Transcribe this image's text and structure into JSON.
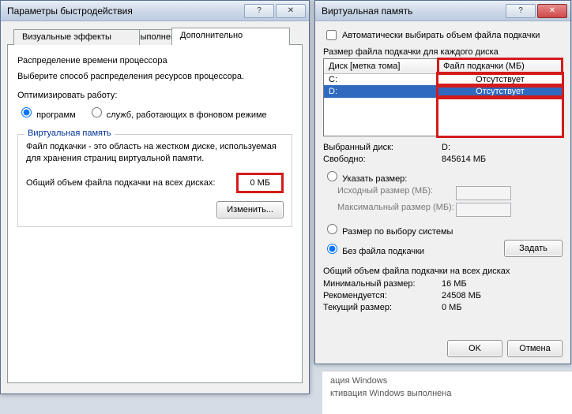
{
  "win1": {
    "title": "Параметры быстродействия",
    "tabs": {
      "dep": "Предотвращение выполнения данных",
      "visual": "Визуальные эффекты",
      "advanced": "Дополнительно"
    },
    "sched_heading": "Распределение времени процессора",
    "sched_text": "Выберите способ распределения ресурсов процессора.",
    "sched_optimize": "Оптимизировать работу:",
    "radio_programs": "программ",
    "radio_services": "служб, работающих в фоновом режиме",
    "vm_legend": "Виртуальная память",
    "vm_text": "Файл подкачки - это область на жестком диске, используемая для хранения страниц виртуальной памяти.",
    "vm_total_label": "Общий объем файла подкачки на всех дисках:",
    "vm_total_value": "0 МБ",
    "change_btn": "Изменить..."
  },
  "win2": {
    "title": "Виртуальная память",
    "auto_manage": "Автоматически выбирать объем файла подкачки",
    "size_each_label": "Размер файла подкачки для каждого диска",
    "col_drive": "Диск [метка тома]",
    "col_pf": "Файл подкачки (МБ)",
    "rows": [
      {
        "drive": "C:",
        "pf": "Отсутствует"
      },
      {
        "drive": "D:",
        "pf": "Отсутствует"
      }
    ],
    "selected_disk_label": "Выбранный диск:",
    "selected_disk": "D:",
    "free_label": "Свободно:",
    "free": "845614 МБ",
    "custom_radio": "Указать размер:",
    "initial_label": "Исходный размер (МБ):",
    "max_label": "Максимальный размер (МБ):",
    "system_radio": "Размер по выбору системы",
    "none_radio": "Без файла подкачки",
    "set_btn": "Задать",
    "total_heading": "Общий объем файла подкачки на всех дисках",
    "min_label": "Минимальный размер:",
    "min_val": "16 МБ",
    "rec_label": "Рекомендуется:",
    "rec_val": "24508 МБ",
    "cur_label": "Текущий размер:",
    "cur_val": "0 МБ",
    "ok": "OK",
    "cancel": "Отмена"
  },
  "win3": {
    "line1": "ация Windows",
    "line2": "ктивация Windows выполнена"
  }
}
